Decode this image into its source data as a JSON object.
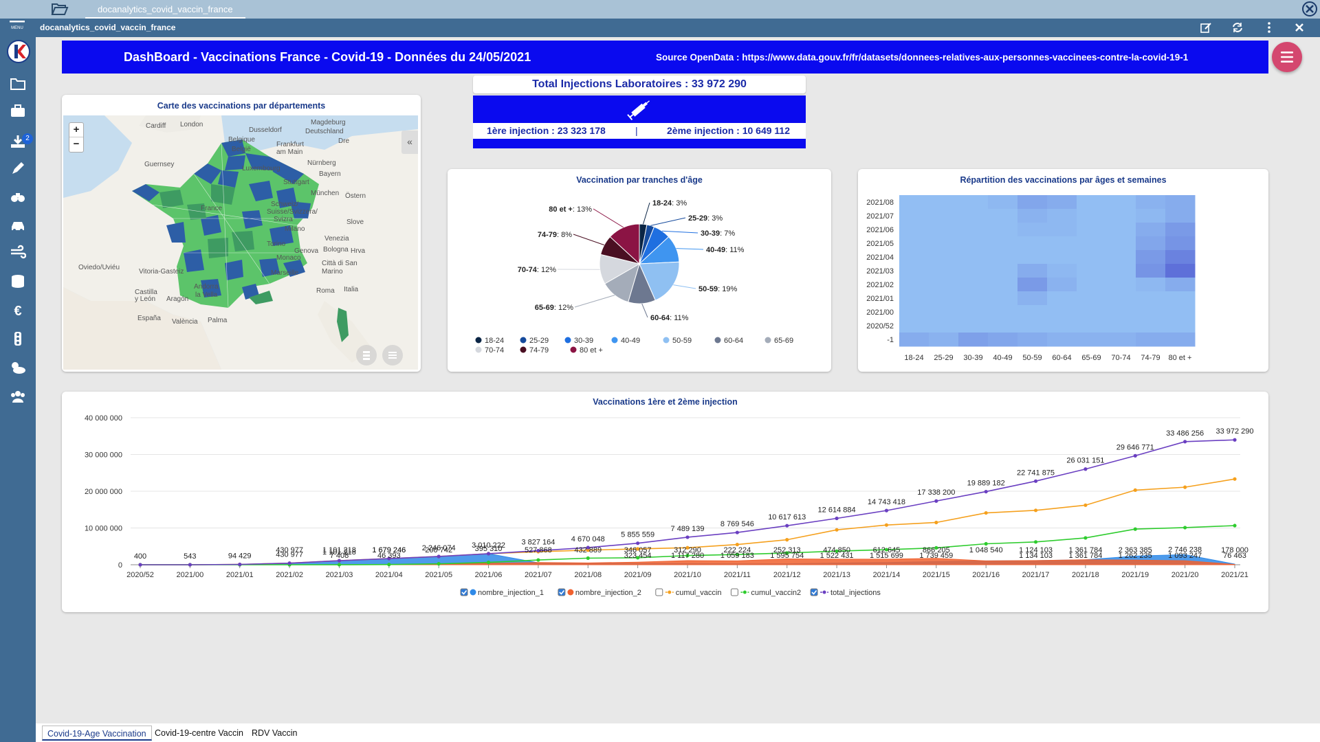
{
  "window": {
    "tab_label": "docanalytics_covid_vaccin_france",
    "subtitle": "docanalytics_covid_vaccin_france",
    "menu_label": "MENU"
  },
  "sidebar": {
    "badge_count": "2"
  },
  "banner": {
    "title": "DashBoard - Vaccinations France - Covid-19 - Données du 24/05/2021",
    "source": "Source OpenData : https://www.data.gouv.fr/fr/datasets/donnees-relatives-aux-personnes-vaccinees-contre-la-covid-19-1"
  },
  "kpi": {
    "total": "Total Injections Laboratoires : 33 972 290",
    "first": "1ère injection : 23 323 178",
    "separator": "|",
    "second": "2ème injection : 10 649 112"
  },
  "map": {
    "title": "Carte des vaccinations par départements",
    "zoom_in": "+",
    "zoom_out": "−",
    "collapse": "«",
    "labels": [
      {
        "text": "Cardiff"
      },
      {
        "text": "London"
      },
      {
        "text": "Dusseldorf"
      },
      {
        "text": "Magdeburg"
      },
      {
        "text": "Deutschland"
      },
      {
        "text": "Frankfurt"
      },
      {
        "text": "am Main"
      },
      {
        "text": "Dre"
      },
      {
        "text": "Belgique"
      },
      {
        "text": "België"
      },
      {
        "text": "Guernsey"
      },
      {
        "text": "Luxembourg"
      },
      {
        "text": "Nürnberg"
      },
      {
        "text": "Stuttgart"
      },
      {
        "text": "Bayern"
      },
      {
        "text": "München"
      },
      {
        "text": "Östern"
      },
      {
        "text": "Schweiz/"
      },
      {
        "text": "Suisse/Svizzera/"
      },
      {
        "text": "Svizra"
      },
      {
        "text": "Slove"
      },
      {
        "text": "Milano"
      },
      {
        "text": "Venezia"
      },
      {
        "text": "Torino"
      },
      {
        "text": "Genova"
      },
      {
        "text": "Bologna"
      },
      {
        "text": "Hrva"
      },
      {
        "text": "Monaco"
      },
      {
        "text": "Città di San"
      },
      {
        "text": "Marino"
      },
      {
        "text": "Marseille"
      },
      {
        "text": "Oviedo/Uviéu"
      },
      {
        "text": "Vitoria-Gasteiz"
      },
      {
        "text": "Andorra"
      },
      {
        "text": "la Vella"
      },
      {
        "text": "Roma"
      },
      {
        "text": "Italia"
      },
      {
        "text": "Castilla"
      },
      {
        "text": "y León"
      },
      {
        "text": "Aragón"
      },
      {
        "text": "España"
      },
      {
        "text": "València"
      },
      {
        "text": "Palma"
      },
      {
        "text": "France"
      }
    ]
  },
  "pie": {
    "title": "Vaccination par tranches d'âge",
    "slices": [
      {
        "label": "18-24",
        "value": 3,
        "color": "#0b2545"
      },
      {
        "label": "25-29",
        "value": 3,
        "color": "#154a9c"
      },
      {
        "label": "30-39",
        "value": 7,
        "color": "#1f6fe0"
      },
      {
        "label": "40-49",
        "value": 11,
        "color": "#3f95f0"
      },
      {
        "label": "50-59",
        "value": 19,
        "color": "#8fc0f2"
      },
      {
        "label": "60-64",
        "value": 11,
        "color": "#6d7890"
      },
      {
        "label": "65-69",
        "value": 12,
        "color": "#a4acb9"
      },
      {
        "label": "70-74",
        "value": 12,
        "color": "#d5d8de"
      },
      {
        "label": "74-79",
        "value": 8,
        "color": "#4a0f22"
      },
      {
        "label": "80 et +",
        "value": 13,
        "color": "#8b1444"
      }
    ]
  },
  "heatmap": {
    "title": "Répartition des vaccinations par âges et semaines",
    "rows": [
      "2021/08",
      "2021/07",
      "2021/06",
      "2021/05",
      "2021/04",
      "2021/03",
      "2021/02",
      "2021/01",
      "2021/00",
      "2020/52",
      "-1"
    ],
    "cols": [
      "18-24",
      "25-29",
      "30-39",
      "40-49",
      "50-59",
      "60-64",
      "65-69",
      "70-74",
      "74-79",
      "80 et +"
    ],
    "intensity": [
      [
        0.05,
        0.05,
        0.05,
        0.1,
        0.25,
        0.2,
        0.05,
        0.05,
        0.15,
        0.2
      ],
      [
        0.05,
        0.05,
        0.05,
        0.05,
        0.15,
        0.1,
        0.05,
        0.05,
        0.1,
        0.2
      ],
      [
        0.05,
        0.05,
        0.05,
        0.05,
        0.1,
        0.1,
        0.05,
        0.05,
        0.2,
        0.35
      ],
      [
        0.05,
        0.05,
        0.05,
        0.05,
        0.05,
        0.05,
        0.05,
        0.05,
        0.25,
        0.4
      ],
      [
        0.05,
        0.05,
        0.05,
        0.05,
        0.05,
        0.05,
        0.05,
        0.05,
        0.35,
        0.55
      ],
      [
        0.05,
        0.05,
        0.05,
        0.05,
        0.2,
        0.1,
        0.05,
        0.05,
        0.4,
        0.7
      ],
      [
        0.05,
        0.05,
        0.05,
        0.05,
        0.35,
        0.15,
        0.05,
        0.05,
        0.1,
        0.2
      ],
      [
        0.05,
        0.05,
        0.05,
        0.05,
        0.15,
        0.05,
        0.05,
        0.05,
        0.05,
        0.05
      ],
      [
        0.05,
        0.05,
        0.05,
        0.05,
        0.05,
        0.05,
        0.05,
        0.05,
        0.05,
        0.05
      ],
      [
        0.05,
        0.05,
        0.05,
        0.05,
        0.05,
        0.05,
        0.05,
        0.05,
        0.05,
        0.05
      ],
      [
        0.2,
        0.15,
        0.3,
        0.25,
        0.2,
        0.15,
        0.15,
        0.15,
        0.2,
        0.2
      ]
    ]
  },
  "chart_data": {
    "type": "line",
    "title": "Vaccinations 1ère et 2ème injection",
    "x": [
      "2020/52",
      "2021/00",
      "2021/01",
      "2021/02",
      "2021/03",
      "2021/04",
      "2021/05",
      "2021/06",
      "2021/07",
      "2021/08",
      "2021/09",
      "2021/10",
      "2021/11",
      "2021/12",
      "2021/13",
      "2021/14",
      "2021/15",
      "2021/16",
      "2021/17",
      "2021/18",
      "2021/19",
      "2021/20",
      "2021/21"
    ],
    "y_ticks": [
      "0",
      "10 000 000",
      "20 000 000",
      "30 000 000",
      "40 000 000"
    ],
    "ylim": [
      0,
      40000000
    ],
    "series": [
      {
        "name": "nombre_injection_1",
        "checked": true,
        "color": "#2f8ae8",
        "values": [
          400,
          543,
          94429,
          430977,
          1101218,
          1679246,
          2246074,
          3010222,
          527868,
          432889,
          346057,
          312290,
          222224,
          252313,
          474850,
          612645,
          866205,
          1048540,
          1124103,
          1361784,
          2363385,
          2746238,
          178000
        ]
      },
      {
        "name": "nombre_injection_2",
        "checked": true,
        "color": "#f0612f",
        "values": [
          0,
          0,
          0,
          0,
          7408,
          46393,
          200742,
          395310,
          600000,
          500000,
          700000,
          1117280,
          1059183,
          1595754,
          1522431,
          1515699,
          1739459,
          1048540,
          1134103,
          1361784,
          1262235,
          1093247,
          76463
        ]
      },
      {
        "name": "cumul_vaccin",
        "checked": false,
        "color": "#f5a01d",
        "values": [
          400,
          543,
          94429,
          430977,
          1101218,
          1679246,
          2246074,
          3010222,
          3538090,
          3970979,
          4317036,
          4629326,
          5500000,
          6800000,
          9500000,
          10800000,
          11500000,
          14100000,
          14800000,
          16200000,
          20300000,
          21100000,
          23323178
        ]
      },
      {
        "name": "cumul_vaccin2",
        "checked": false,
        "color": "#2ecc2e",
        "values": [
          0,
          0,
          0,
          0,
          7408,
          53801,
          254543,
          649853,
          1289958,
          1797000,
          1900000,
          2500000,
          2800000,
          3200000,
          3700000,
          4100000,
          4600000,
          5700000,
          6200000,
          7300000,
          9700000,
          10100000,
          10649112
        ]
      },
      {
        "name": "total_injections",
        "checked": true,
        "color": "#6a3fc1",
        "values": [
          400,
          543,
          94429,
          430977,
          1101218,
          1679246,
          2246074,
          3010222,
          3827164,
          4670048,
          5855559,
          7489139,
          8769546,
          10617613,
          12614884,
          14743418,
          17338200,
          19889182,
          22741875,
          26031151,
          29646771,
          33486256,
          33972290
        ]
      }
    ],
    "total_labels": [
      "400",
      "543",
      "94 429",
      "430 977",
      "1 101 218",
      "1 679 246",
      "2 246 074",
      "3 010 222",
      "3 827 164",
      "4 670 048",
      "5 855 559",
      "7 489 139",
      "8 769 546",
      "10 617 613",
      "12 614 884",
      "14 743 418",
      "17 338 200",
      "19 889 182",
      "22 741 875",
      "26 031 151",
      "29 646 771",
      "33 486 256",
      "33 972 290"
    ],
    "inj1_labels": [
      "",
      "",
      "",
      "430 977",
      "1 101 218",
      "1 679 246",
      "200 742",
      "395 310",
      "527 868",
      "432 889",
      "346 057",
      "312 290",
      "222 224",
      "252 313",
      "474 850",
      "612 645",
      "866 205",
      "1 048 540",
      "1 124 103",
      "1 361 784",
      "2 363 385",
      "2 746 238",
      "178 000"
    ],
    "inj2_labels": [
      "",
      "",
      "",
      "",
      "7 408",
      "46 393",
      "",
      "",
      "",
      "",
      "323 454",
      "1 117 280",
      "1 059 183",
      "1 595 754",
      "1 522 431",
      "1 515 699",
      "1 739 459",
      "",
      "1 134 103",
      "1 361 784",
      "1 262 235",
      "1 093 247",
      "76 463"
    ]
  },
  "bottom_tabs": [
    {
      "label": "Covid-19-Age Vaccination"
    },
    {
      "label": "Covid-19-centre Vaccin"
    },
    {
      "label": "RDV Vaccin"
    }
  ]
}
